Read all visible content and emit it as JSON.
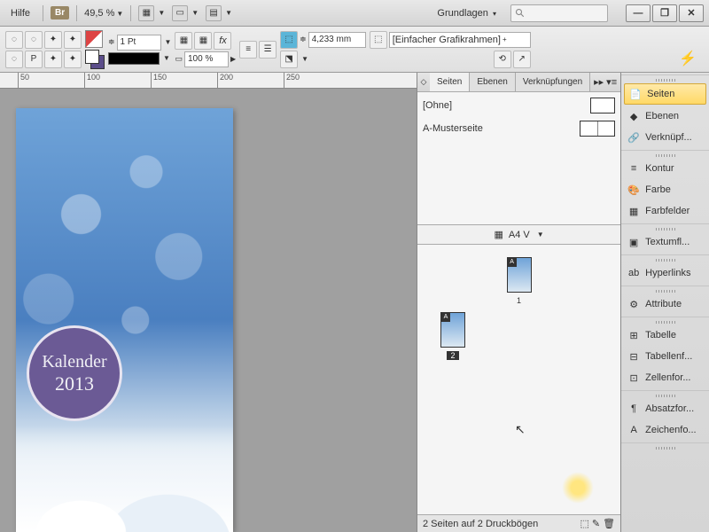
{
  "menubar": {
    "help": "Hilfe",
    "br": "Br",
    "zoom": "49,5 %",
    "workspace": "Grundlagen",
    "search_ph": "",
    "min": "—",
    "max": "❐",
    "close": "✕"
  },
  "toolbar": {
    "stroke": "1 Pt",
    "opacity": "100 %",
    "measure": "4,233 mm",
    "frame": "[Einfacher Grafikrahmen]"
  },
  "ruler": {
    "t50": "50",
    "t100": "100",
    "t150": "150",
    "t200": "200",
    "t250": "250"
  },
  "calendar": {
    "title": "Kalender",
    "year": "2013"
  },
  "tabs": {
    "seiten": "Seiten",
    "ebenen": "Ebenen",
    "verkn": "Verknüpfungen"
  },
  "masters": {
    "none": "[Ohne]",
    "a": "A-Musterseite"
  },
  "pagesize": "A4 V",
  "pages": {
    "p1": "1",
    "p2": "2",
    "cornerA": "A"
  },
  "status": "2 Seiten auf 2 Druckbögen",
  "dock": {
    "seiten": "Seiten",
    "ebenen": "Ebenen",
    "verkn": "Verknüpf...",
    "kontur": "Kontur",
    "farbe": "Farbe",
    "felder": "Farbfelder",
    "textumfl": "Textumfl...",
    "hyperlinks": "Hyperlinks",
    "attribute": "Attribute",
    "tabelle": "Tabelle",
    "tabellenf": "Tabellenf...",
    "zellenf": "Zellenfor...",
    "absatz": "Absatzfor...",
    "zeichen": "Zeichenfo..."
  }
}
